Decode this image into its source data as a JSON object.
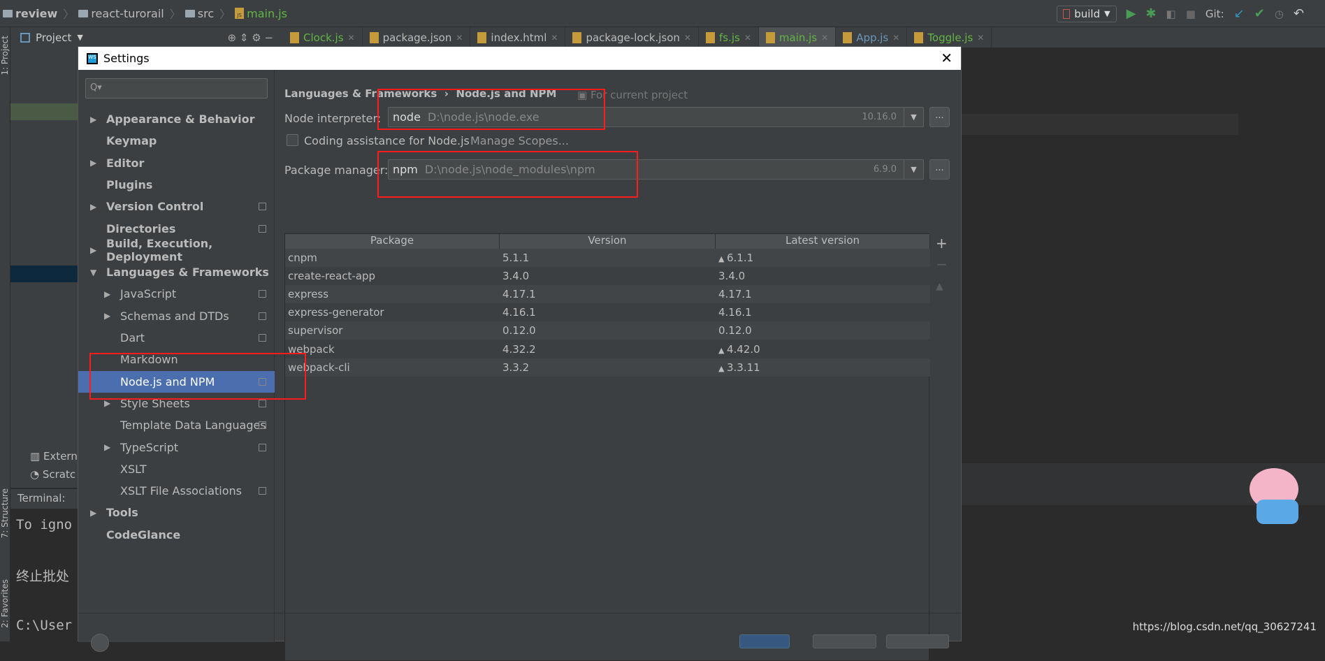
{
  "navbar": {
    "crumbs": [
      "review",
      "react-turorail",
      "src",
      "main.js"
    ],
    "run_config": "build",
    "git_label": "Git:"
  },
  "project_panel": {
    "title": "Project",
    "items": [
      "Extern",
      "Scratc"
    ],
    "terminal_label": "Terminal:",
    "terminal_lines": [
      "To igno",
      "终止批处",
      "C:\\User"
    ],
    "side_tabs": [
      "1: Project",
      "7: Structure",
      "2: Favorites"
    ]
  },
  "tabs": [
    {
      "label": "Clock.js",
      "color": "#62b543"
    },
    {
      "label": "package.json",
      "color": "#bbbbbb"
    },
    {
      "label": "index.html",
      "color": "#bbbbbb"
    },
    {
      "label": "package-lock.json",
      "color": "#bbbbbb"
    },
    {
      "label": "fs.js",
      "color": "#62b543"
    },
    {
      "label": "main.js",
      "color": "#62b543",
      "active": true
    },
    {
      "label": "App.js",
      "color": "#6897bb"
    },
    {
      "label": "Toggle.js",
      "color": "#62b543"
    }
  ],
  "dialog": {
    "title": "Settings",
    "search_placeholder": "Q▾",
    "tree": [
      {
        "label": "Appearance & Behavior",
        "level": 0,
        "bold": true,
        "arrow": "▶"
      },
      {
        "label": "Keymap",
        "level": 0,
        "bold": true
      },
      {
        "label": "Editor",
        "level": 0,
        "bold": true,
        "arrow": "▶"
      },
      {
        "label": "Plugins",
        "level": 0,
        "bold": true
      },
      {
        "label": "Version Control",
        "level": 0,
        "bold": true,
        "arrow": "▶",
        "copy": true
      },
      {
        "label": "Directories",
        "level": 0,
        "bold": true,
        "copy": true
      },
      {
        "label": "Build, Execution, Deployment",
        "level": 0,
        "bold": true,
        "arrow": "▶"
      },
      {
        "label": "Languages & Frameworks",
        "level": 0,
        "bold": true,
        "arrow": "▼"
      },
      {
        "label": "JavaScript",
        "level": 1,
        "arrow": "▶",
        "copy": true
      },
      {
        "label": "Schemas and DTDs",
        "level": 1,
        "arrow": "▶",
        "copy": true
      },
      {
        "label": "Dart",
        "level": 1,
        "copy": true
      },
      {
        "label": "Markdown",
        "level": 1
      },
      {
        "label": "Node.js and NPM",
        "level": 1,
        "copy": true,
        "selected": true
      },
      {
        "label": "Style Sheets",
        "level": 1,
        "arrow": "▶",
        "copy": true
      },
      {
        "label": "Template Data Languages",
        "level": 1,
        "copy": true
      },
      {
        "label": "TypeScript",
        "level": 1,
        "arrow": "▶",
        "copy": true
      },
      {
        "label": "XSLT",
        "level": 1
      },
      {
        "label": "XSLT File Associations",
        "level": 1,
        "copy": true
      },
      {
        "label": "Tools",
        "level": 0,
        "bold": true,
        "arrow": "▶"
      },
      {
        "label": "CodeGlance",
        "level": 0,
        "bold": true
      }
    ],
    "breadcrumb": {
      "parent": "Languages & Frameworks",
      "sep": "›",
      "current": "Node.js and NPM",
      "scope": "For current project"
    },
    "node_interpreter": {
      "label": "Node interpreter:",
      "name": "node",
      "path": "D:\\node.js\\node.exe",
      "version": "10.16.0"
    },
    "coding_assistance": {
      "label": "Coding assistance for Node.js",
      "checked": false,
      "manage": "Manage Scopes..."
    },
    "package_manager": {
      "label": "Package manager:",
      "name": "npm",
      "path": "D:\\node.js\\node_modules\\npm",
      "version": "6.9.0"
    },
    "browse_label": "...",
    "table": {
      "columns": [
        "Package",
        "Version",
        "Latest version"
      ],
      "rows": [
        {
          "package": "cnpm",
          "version": "5.1.1",
          "latest": "6.1.1",
          "upgrade": true
        },
        {
          "package": "create-react-app",
          "version": "3.4.0",
          "latest": "3.4.0",
          "upgrade": false
        },
        {
          "package": "express",
          "version": "4.17.1",
          "latest": "4.17.1",
          "upgrade": false
        },
        {
          "package": "express-generator",
          "version": "4.16.1",
          "latest": "4.16.1",
          "upgrade": false
        },
        {
          "package": "supervisor",
          "version": "0.12.0",
          "latest": "0.12.0",
          "upgrade": false
        },
        {
          "package": "webpack",
          "version": "4.32.2",
          "latest": "4.42.0",
          "upgrade": true
        },
        {
          "package": "webpack-cli",
          "version": "3.3.2",
          "latest": "3.3.11",
          "upgrade": true
        }
      ]
    },
    "side_buttons": {
      "add": "+",
      "remove": "−",
      "upgrade": "▲"
    }
  },
  "watermark": "https://blog.csdn.net/qq_30627241",
  "colors": {
    "selection": "#4b6eaf",
    "highlight_box": "#ff1c1c",
    "bg": "#3c3f41",
    "editor": "#2b2b2b"
  }
}
